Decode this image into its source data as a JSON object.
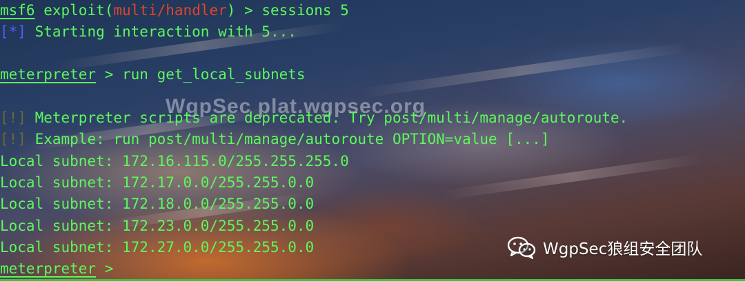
{
  "terminal": {
    "prompt_msf": "msf6",
    "cmd_exploit": "exploit",
    "module_open": "(",
    "module_name": "multi/handler",
    "module_close": ")",
    "cmd1": " > sessions 5",
    "info_bracket": "[*]",
    "info_text": " Starting interaction with 5...",
    "prompt_meterpreter": "meterpreter",
    "cmd2": " > run get_local_subnets",
    "warn_bracket": "[!]",
    "warn1": " Meterpreter scripts are deprecated. Try post/multi/manage/autoroute.",
    "warn2": " Example: run post/multi/manage/autoroute OPTION=value [...]",
    "subnets": [
      "Local subnet: 172.16.115.0/255.255.255.0",
      "Local subnet: 172.17.0.0/255.255.0.0",
      "Local subnet: 172.18.0.0/255.255.0.0",
      "Local subnet: 172.23.0.0/255.255.0.0",
      "Local subnet: 172.27.0.0/255.255.0.0"
    ],
    "final_prompt_tail": " >"
  },
  "watermark": "WgpSec plat.wgpsec.org",
  "brand": {
    "icon": "wechat-icon",
    "text": "WgpSec狼组安全团队"
  },
  "colors": {
    "terminal_green": "#5df85d",
    "module_red": "#e0442f",
    "info_blue": "#5b5bf0"
  }
}
